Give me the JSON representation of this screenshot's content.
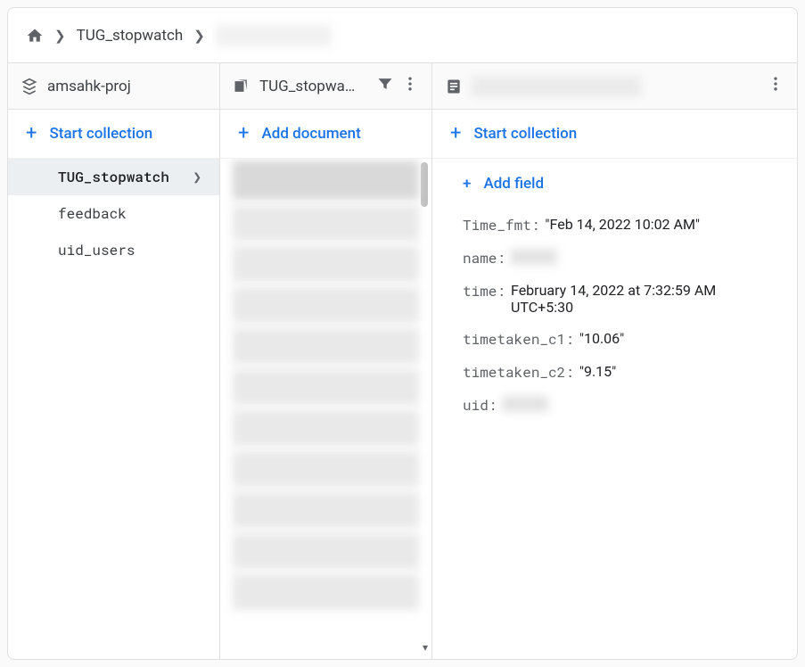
{
  "breadcrumb": {
    "collection": "TUG_stopwatch",
    "document_redacted": true
  },
  "columns": {
    "project": {
      "name": "amsahk-proj",
      "start_collection_label": "Start collection",
      "items": [
        {
          "label": "TUG_stopwatch",
          "active": true
        },
        {
          "label": "feedback",
          "active": false
        },
        {
          "label": "uid_users",
          "active": false
        }
      ]
    },
    "collection": {
      "name": "TUG_stopwa…",
      "add_document_label": "Add document",
      "docs_redacted_count": 12
    },
    "document": {
      "header_redacted": true,
      "start_collection_label": "Start collection",
      "add_field_label": "Add field",
      "fields": [
        {
          "key": "Time_fmt:",
          "value": "\"Feb 14, 2022 10:02 AM\""
        },
        {
          "key": "name:",
          "value_redacted": true
        },
        {
          "key": "time:",
          "value": "February 14, 2022 at 7:32:59 AM UTC+5:30"
        },
        {
          "key": "timetaken_c1:",
          "value": "\"10.06\""
        },
        {
          "key": "timetaken_c2:",
          "value": "\"9.15\""
        },
        {
          "key": "uid:",
          "value_redacted": true
        }
      ]
    }
  }
}
